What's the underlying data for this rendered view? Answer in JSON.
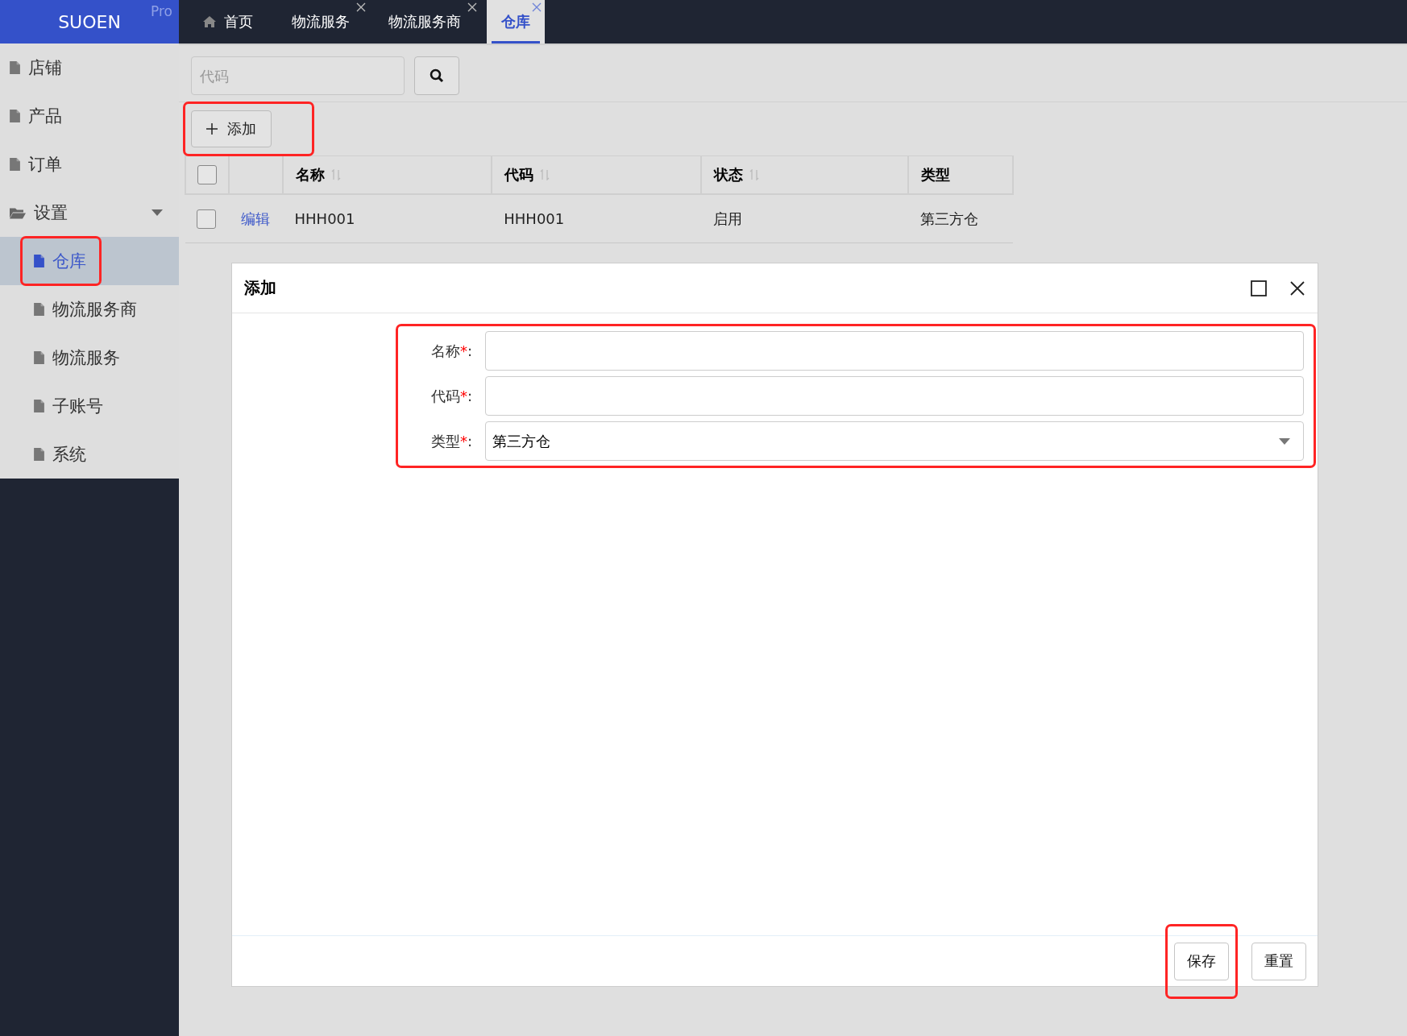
{
  "brand": {
    "name": "SUOEN",
    "badge": "Pro"
  },
  "tabs": [
    {
      "label": "首页",
      "kind": "home",
      "closable": false,
      "selected": false
    },
    {
      "label": "物流服务",
      "kind": "page",
      "closable": true,
      "selected": false
    },
    {
      "label": "物流服务商",
      "kind": "page",
      "closable": true,
      "selected": false
    },
    {
      "label": "仓库",
      "kind": "page",
      "closable": true,
      "selected": true
    }
  ],
  "sidebar": {
    "items": [
      {
        "label": "店铺",
        "kind": "page",
        "selected": false,
        "highlighted": false
      },
      {
        "label": "产品",
        "kind": "page",
        "selected": false,
        "highlighted": false
      },
      {
        "label": "订单",
        "kind": "page",
        "selected": false,
        "highlighted": false
      },
      {
        "label": "设置",
        "kind": "folder",
        "expanded": true,
        "selected": false,
        "highlighted": false,
        "children": [
          {
            "label": "仓库",
            "kind": "page",
            "selected": true,
            "highlighted": true
          },
          {
            "label": "物流服务商",
            "kind": "page",
            "selected": false,
            "highlighted": false
          },
          {
            "label": "物流服务",
            "kind": "page",
            "selected": false,
            "highlighted": false
          },
          {
            "label": "子账号",
            "kind": "page",
            "selected": false,
            "highlighted": false
          },
          {
            "label": "系统",
            "kind": "page",
            "selected": false,
            "highlighted": false
          }
        ]
      }
    ]
  },
  "search": {
    "placeholder": "代码"
  },
  "add_button": {
    "label": "添加",
    "highlighted": true
  },
  "table": {
    "select_all_checked": false,
    "columns": [
      {
        "label": "名称",
        "sortable": true
      },
      {
        "label": "代码",
        "sortable": true
      },
      {
        "label": "状态",
        "sortable": true
      },
      {
        "label": "类型",
        "sortable": false
      }
    ],
    "rows": [
      {
        "checked": false,
        "action": "编辑",
        "cells": [
          "HHH001",
          "HHH001",
          "启用",
          "第三方仓"
        ]
      }
    ]
  },
  "dialog": {
    "title": "添加",
    "form_highlighted": true,
    "fields": [
      {
        "label": "名称",
        "required_mark": "*",
        "colon": ":",
        "kind": "text"
      },
      {
        "label": "代码",
        "required_mark": "*",
        "colon": ":",
        "kind": "text"
      },
      {
        "label": "类型",
        "required_mark": "*",
        "colon": ":",
        "kind": "select",
        "value": "第三方仓"
      }
    ],
    "buttons": [
      {
        "label": "保存",
        "highlighted": true
      },
      {
        "label": "重置",
        "highlighted": false
      }
    ]
  }
}
